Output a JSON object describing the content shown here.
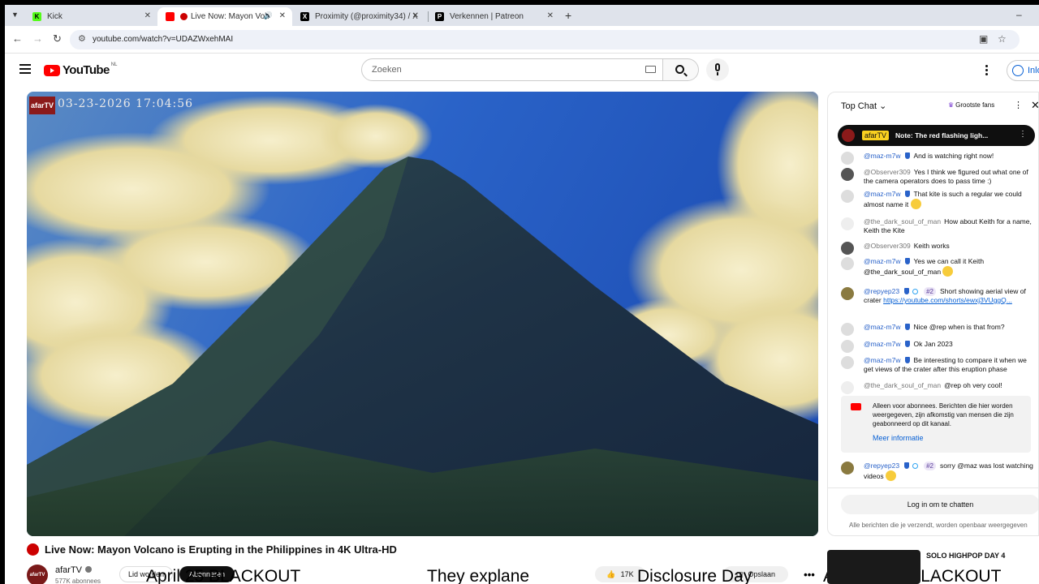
{
  "browser": {
    "tabs": [
      {
        "title": "Kick",
        "favicon_color": "#53fc18",
        "favicon_letter": "K"
      },
      {
        "title": "Live Now: Mayon Volca",
        "favicon_color": "#ff0000",
        "favicon_letter": ""
      },
      {
        "title": "Proximity (@proximity34) / X",
        "favicon_color": "#000000",
        "favicon_letter": "X"
      },
      {
        "title": "Verkennen | Patreon",
        "favicon_color": "#000000",
        "favicon_letter": "P"
      }
    ],
    "url": "youtube.com/watch?v=UDAZWxehMAI"
  },
  "yt": {
    "logo": "YouTube",
    "region": "NL",
    "search_placeholder": "Zoeken",
    "signin": "Inlo"
  },
  "video": {
    "cam_logo": "afarTV",
    "cam_timestamp": "03-23-2026 17:04:56",
    "title": "Live Now: Mayon Volcano is Erupting in the Philippines in 4K Ultra-HD"
  },
  "channel": {
    "name": "afarTV",
    "subs": "577K abonnees",
    "join": "Lid worden",
    "subscribe": "Abonneren",
    "likes": "17K",
    "save": "Opslaan",
    "more": "•••"
  },
  "overlay_text": [
    "April 25 BLACKOUT",
    "They explane",
    "Disclosure Day",
    "April 25/26 BLACKOUT"
  ],
  "chat": {
    "title": "Top Chat",
    "fans": "Grootste fans",
    "pinned": {
      "badge": "afarTV",
      "text": "Note: The red flashing ligh..."
    },
    "messages": [
      {
        "author": "@maz-m7w",
        "mod": true,
        "text": "And is watching right now!"
      },
      {
        "author": "@Observer309",
        "mod": false,
        "text": "Yes I think we figured out what one of the camera operators does to pass time :)"
      },
      {
        "author": "@maz-m7w",
        "mod": true,
        "text": "That kite is such a regular we could almost name it"
      },
      {
        "author": "@the_dark_soul_of_man",
        "mod": false,
        "text": "How about Keith for a name, Keith the Kite"
      },
      {
        "author": "@Observer309",
        "mod": false,
        "text": "Keith works"
      },
      {
        "author": "@maz-m7w",
        "mod": true,
        "text": "Yes we can call it Keith @the_dark_soul_of_man"
      },
      {
        "author": "@repyep23",
        "mod": true,
        "rank": "#2",
        "text": "Short showing aerial view of crater",
        "link": "https://youtube.com/shorts/ewxj3VUggQ..."
      },
      {
        "author": "@maz-m7w",
        "mod": true,
        "text": "Nice @rep when is that from?"
      },
      {
        "author": "@maz-m7w",
        "mod": true,
        "text": "Ok Jan 2023"
      },
      {
        "author": "@maz-m7w",
        "mod": true,
        "text": "Be interesting to compare it when we get views of the crater after this eruption phase"
      },
      {
        "author": "@the_dark_soul_of_man",
        "mod": false,
        "text": "@rep oh very cool!"
      },
      {
        "author": "@repyep23",
        "mod": true,
        "rank": "#2",
        "text": "sorry @maz was lost watching videos"
      }
    ],
    "notice": "Alleen voor abonnees. Berichten die hier worden weergegeven, zijn afkomstig van mensen die zijn geabonneerd op dit kanaal.",
    "notice_link": "Meer informatie",
    "login": "Log in om te chatten",
    "footer": "Alle berichten die je verzendt, worden openbaar weergegeven"
  },
  "next_video": {
    "title": "SOLO HIGHPOP DAY 4"
  }
}
